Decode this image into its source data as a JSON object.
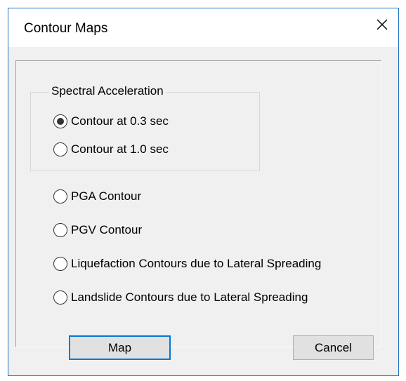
{
  "dialog": {
    "title": "Contour Maps",
    "close_icon": "close-icon"
  },
  "spectral_group": {
    "legend": "Spectral  Acceleration",
    "options": [
      {
        "label": "Contour at 0.3 sec",
        "checked": true
      },
      {
        "label": "Contour at 1.0 sec",
        "checked": false
      }
    ]
  },
  "options": [
    {
      "label": "PGA Contour",
      "checked": false
    },
    {
      "label": "PGV Contour",
      "checked": false
    },
    {
      "label": "Liquefaction Contours due to Lateral Spreading",
      "checked": false
    },
    {
      "label": "Landslide Contours due to Lateral Spreading",
      "checked": false
    }
  ],
  "buttons": {
    "map_label": "Map",
    "cancel_label": "Cancel"
  },
  "colors": {
    "accent": "#0078d7",
    "border": "#1e73c8",
    "face": "#f0f0f0"
  }
}
